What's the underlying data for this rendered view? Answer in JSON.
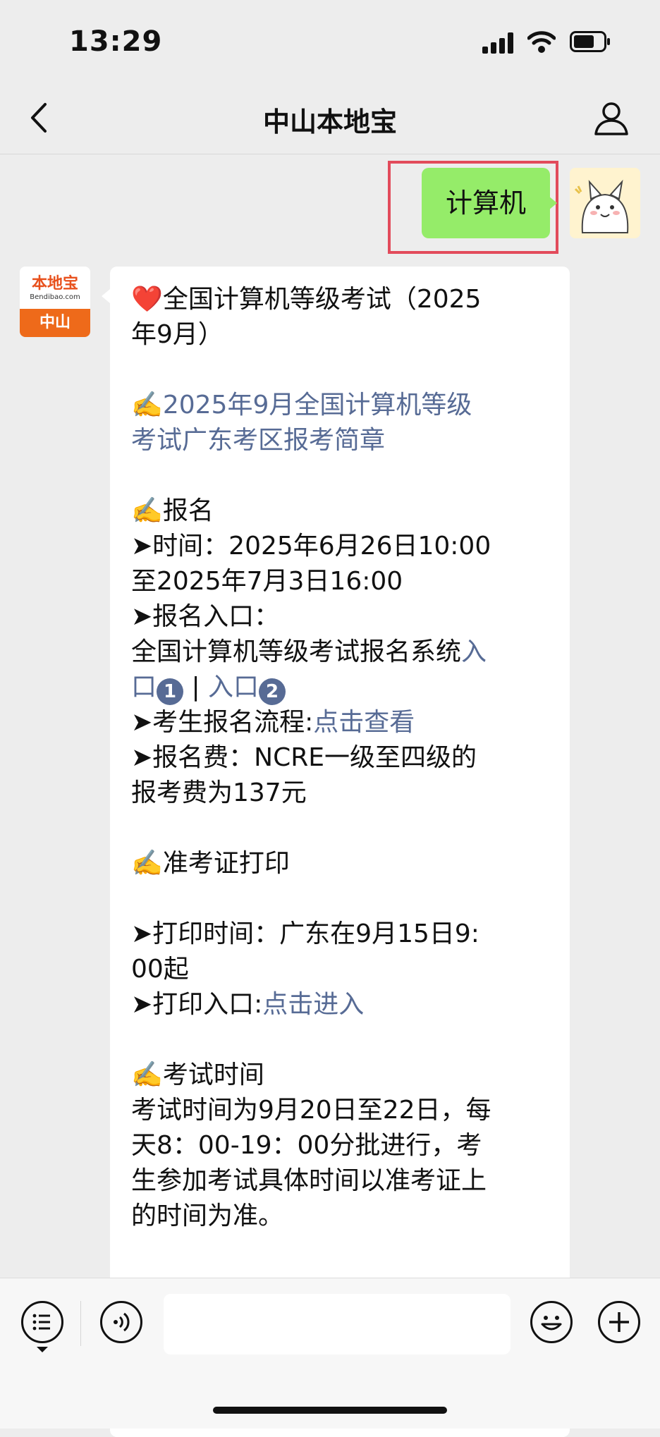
{
  "status_bar": {
    "time": "13:29"
  },
  "nav": {
    "title": "中山本地宝"
  },
  "sent_message": {
    "text": "计算机"
  },
  "logo": {
    "cn": "本地宝",
    "en": "Bendibao.com",
    "city": "中山"
  },
  "message": {
    "l1": "❤️全国计算机等级考试（2025",
    "l2": "年9月）",
    "l3": "✍️2025年9月全国计算机等级",
    "l4": "考试广东考区报考简章",
    "l5": "✍️报名",
    "l6": "➤时间：2025年6月26日10:00",
    "l7": "至2025年7月3日16:00",
    "l8": "➤报名入口：",
    "l9a": "全国计算机等级考试报名系统",
    "l9b": "入",
    "l10a": "口",
    "l10b": "1",
    "l10c": " | ",
    "l10d": "入口",
    "l10e": "2",
    "l11a": "➤考生报名流程:",
    "l11b": "点击查看",
    "l12": "➤报名费：NCRE一级至四级的",
    "l13": "报考费为137元",
    "l14": "✍️准考证打印",
    "l15": "➤打印时间：广东在9月15日9:",
    "l16": "00起",
    "l17a": "➤打印入口:",
    "l17b": "点击进入",
    "l18": "✍️考试时间",
    "l19": "考试时间为9月20日至22日，每",
    "l20": "天8：00-19：00分批进行，考",
    "l21": "生参加考试具体时间以准考证上",
    "l22": "的时间为准。"
  },
  "toolbar": {
    "menu_icon": "list-icon",
    "voice_icon": "voice-icon",
    "emoji_icon": "emoji-icon",
    "plus_icon": "plus-icon"
  },
  "colors": {
    "sent_bubble": "#95ec69",
    "link": "#576b95",
    "highlight_box": "#e24b5b"
  }
}
